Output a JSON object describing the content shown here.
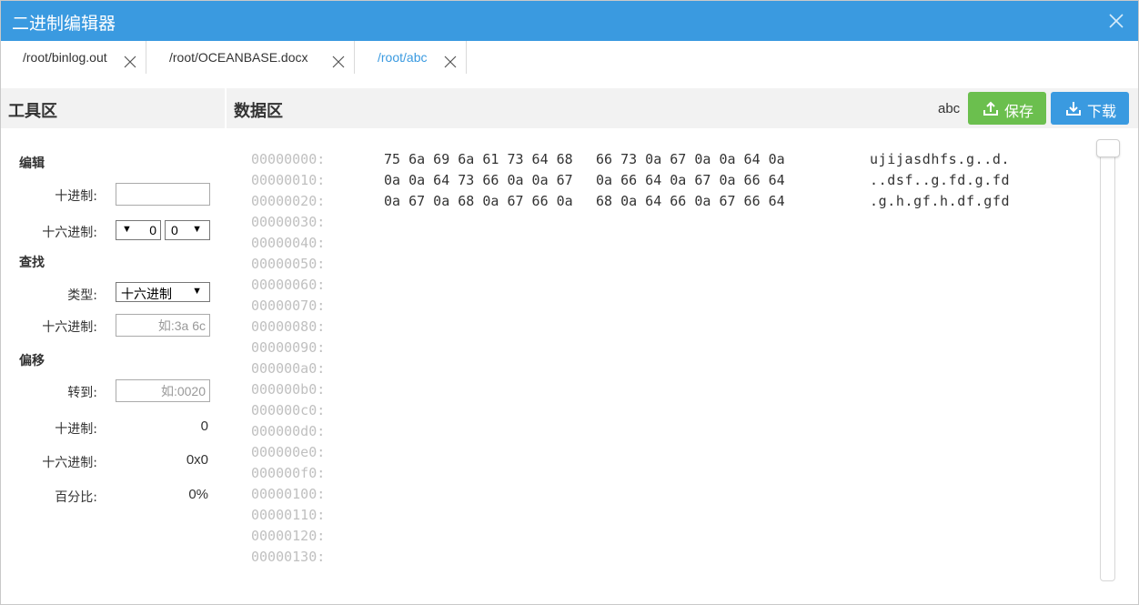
{
  "window": {
    "title": "二进制编辑器",
    "accent": "#3a9ae0",
    "close_icon": "close-icon"
  },
  "tabs": [
    {
      "label": "/root/binlog.out",
      "active": false
    },
    {
      "label": "/root/OCEANBASE.docx",
      "active": false
    },
    {
      "label": "/root/abc",
      "active": true
    }
  ],
  "toolbar": {
    "tools_title": "工具区",
    "data_title": "数据区",
    "encoding": "abc",
    "save_label": "保存",
    "save_icon": "upload-icon",
    "save_color": "#6bbf4e",
    "download_label": "下载",
    "download_icon": "download-icon",
    "download_color": "#3a9ae0"
  },
  "sidebar": {
    "edit": {
      "heading": "编辑",
      "decimal_label": "十进制:",
      "decimal_value": "",
      "hex_label": "十六进制:",
      "hex_nibble_high": "0",
      "hex_nibble_low": "0"
    },
    "find": {
      "heading": "查找",
      "type_label": "类型:",
      "type_value": "十六进制",
      "hex_label": "十六进制:",
      "hex_placeholder": "如:3a 6c"
    },
    "offset": {
      "heading": "偏移",
      "goto_label": "转到:",
      "goto_placeholder": "如:0020",
      "decimal_label": "十进制:",
      "decimal_value": "0",
      "hex_label": "十六进制:",
      "hex_value": "0x0",
      "percent_label": "百分比:",
      "percent_value": "0%"
    }
  },
  "hex_rows": [
    {
      "offset": "00000000:",
      "hex1": "75 6a 69 6a 61 73 64 68",
      "hex2": "66 73 0a 67 0a 0a 64 0a",
      "ascii": "ujijasdhfs.g..d."
    },
    {
      "offset": "00000010:",
      "hex1": "0a 0a 64 73 66 0a 0a 67",
      "hex2": "0a 66 64 0a 67 0a 66 64",
      "ascii": "..dsf..g.fd.g.fd"
    },
    {
      "offset": "00000020:",
      "hex1": "0a 67 0a 68 0a 67 66 0a",
      "hex2": "68 0a 64 66 0a 67 66 64",
      "ascii": ".g.h.gf.h.df.gfd"
    },
    {
      "offset": "00000030:",
      "hex1": "",
      "hex2": "",
      "ascii": ""
    },
    {
      "offset": "00000040:",
      "hex1": "",
      "hex2": "",
      "ascii": ""
    },
    {
      "offset": "00000050:",
      "hex1": "",
      "hex2": "",
      "ascii": ""
    },
    {
      "offset": "00000060:",
      "hex1": "",
      "hex2": "",
      "ascii": ""
    },
    {
      "offset": "00000070:",
      "hex1": "",
      "hex2": "",
      "ascii": ""
    },
    {
      "offset": "00000080:",
      "hex1": "",
      "hex2": "",
      "ascii": ""
    },
    {
      "offset": "00000090:",
      "hex1": "",
      "hex2": "",
      "ascii": ""
    },
    {
      "offset": "000000a0:",
      "hex1": "",
      "hex2": "",
      "ascii": ""
    },
    {
      "offset": "000000b0:",
      "hex1": "",
      "hex2": "",
      "ascii": ""
    },
    {
      "offset": "000000c0:",
      "hex1": "",
      "hex2": "",
      "ascii": ""
    },
    {
      "offset": "000000d0:",
      "hex1": "",
      "hex2": "",
      "ascii": ""
    },
    {
      "offset": "000000e0:",
      "hex1": "",
      "hex2": "",
      "ascii": ""
    },
    {
      "offset": "000000f0:",
      "hex1": "",
      "hex2": "",
      "ascii": ""
    },
    {
      "offset": "00000100:",
      "hex1": "",
      "hex2": "",
      "ascii": ""
    },
    {
      "offset": "00000110:",
      "hex1": "",
      "hex2": "",
      "ascii": ""
    },
    {
      "offset": "00000120:",
      "hex1": "",
      "hex2": "",
      "ascii": ""
    },
    {
      "offset": "00000130:",
      "hex1": "",
      "hex2": "",
      "ascii": ""
    }
  ]
}
